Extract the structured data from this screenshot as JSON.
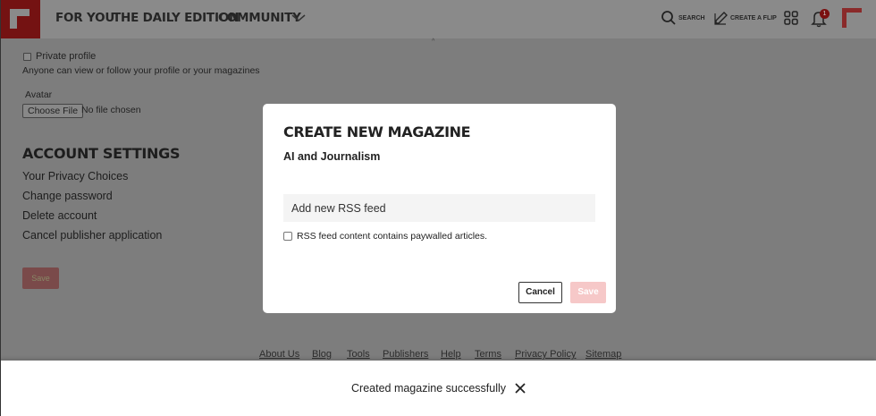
{
  "header": {
    "nav": [
      "FOR YOU",
      "THE DAILY EDITION",
      "COMMUNITY"
    ],
    "search_label": "SEARCH",
    "create_label": "CREATE A FLIP",
    "notification_count": "1"
  },
  "profile": {
    "private_profile_label": "Private profile",
    "private_profile_help": "Anyone can view or follow your profile or your magazines",
    "avatar_label": "Avatar",
    "choose_file": "Choose File",
    "no_file": "No file chosen"
  },
  "account": {
    "title": "ACCOUNT SETTINGS",
    "links": [
      "Your Privacy Choices",
      "Change password",
      "Delete account",
      "Cancel publisher application"
    ],
    "save_label": "Save"
  },
  "modal": {
    "title": "CREATE NEW MAGAZINE",
    "subtitle": "AI and Journalism",
    "rss_placeholder": "Add new RSS feed",
    "paywall_label": "RSS feed content contains paywalled articles.",
    "cancel_label": "Cancel",
    "save_label": "Save"
  },
  "footer": {
    "links": [
      "About Us",
      "Blog",
      "Tools",
      "Publishers",
      "Help",
      "Terms",
      "Privacy Policy",
      "Sitemap"
    ]
  },
  "toast": {
    "message": "Created magazine successfully"
  }
}
